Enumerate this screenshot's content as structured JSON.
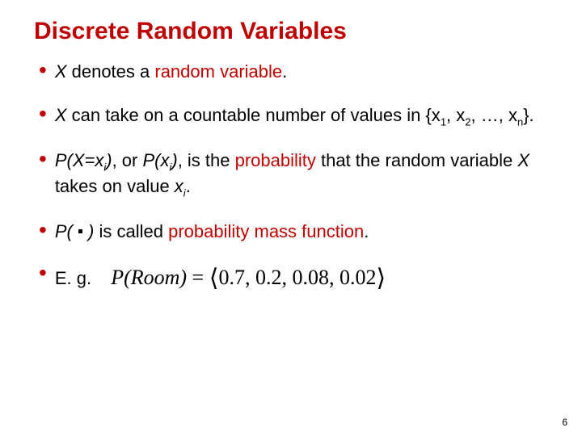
{
  "title": "Discrete Random Variables",
  "bullets": {
    "b1": {
      "X": "X",
      "t1": " denotes a ",
      "rv": "random variable",
      "t2": "."
    },
    "b2": {
      "X": "X",
      "t1": " can take on a countable number of values in {x",
      "s1": "1",
      "t2": ", x",
      "s2": "2",
      "t3": ", …, x",
      "sn": "n",
      "t4": "}."
    },
    "b3": {
      "p1": "P(X=x",
      "si1": "i",
      "p2": ")",
      "t1": ", or ",
      "p3": "P(x",
      "si2": "i",
      "p4": ")",
      "t2": ", is the ",
      "prob": "probability",
      "t3": " that the random variable ",
      "X": "X",
      "t4": " takes on value ",
      "xi": "x",
      "si3": "i",
      "t5": "."
    },
    "b4": {
      "p1": "P( ",
      "p2": " )",
      "t1": " is called ",
      "pmf": "probability mass function",
      "t2": "."
    },
    "b5": {
      "eg": "E. g.",
      "eq_lhs": "P(Room)",
      "eq_eq": " = ",
      "eq_vals": "0.7, 0.2, 0.08, 0.02"
    }
  },
  "page_number": "6"
}
